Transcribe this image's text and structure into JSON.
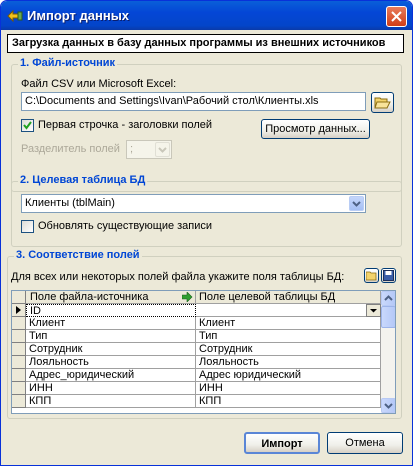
{
  "window": {
    "title": "Импорт данных"
  },
  "header": "Загрузка данных в базу данных программы из внешних источников",
  "source": {
    "group_title": "1. Файл-источник",
    "file_label": "Файл CSV или Microsoft Excel:",
    "file_path": "C:\\Documents and Settings\\Ivan\\Рабочий стол\\Клиенты.xls",
    "first_row_headers_label": "Первая строчка - заголовки полей",
    "first_row_headers_checked": true,
    "preview_button": "Просмотр данных...",
    "separator_label": "Разделитель полей",
    "separator_value": ";"
  },
  "target": {
    "group_title": "2. Целевая таблица БД",
    "table_value": "Клиенты (tblMain)",
    "update_existing_label": "Обновлять существующие записи",
    "update_existing_checked": false
  },
  "mapping": {
    "group_title": "3. Соответствие полей",
    "instruction": "Для всех или некоторых полей файла укажите поля таблицы БД:",
    "col_source": "Поле файла-источника",
    "col_target": "Поле целевой таблицы БД",
    "rows": [
      {
        "source": "ID",
        "target": ""
      },
      {
        "source": "Клиент",
        "target": "Клиент"
      },
      {
        "source": "Тип",
        "target": "Тип"
      },
      {
        "source": "Сотрудник",
        "target": "Сотрудник"
      },
      {
        "source": "Лояльность",
        "target": "Лояльность"
      },
      {
        "source": "Адрес_юридический",
        "target": "Адрес юридический"
      },
      {
        "source": "ИНН",
        "target": "ИНН"
      },
      {
        "source": "КПП",
        "target": "КПП"
      }
    ]
  },
  "buttons": {
    "import": "Импорт",
    "cancel": "Отмена"
  },
  "colors": {
    "title_bar": "#0a5fd8",
    "group_title": "#0046d5",
    "face": "#ece9d8"
  }
}
